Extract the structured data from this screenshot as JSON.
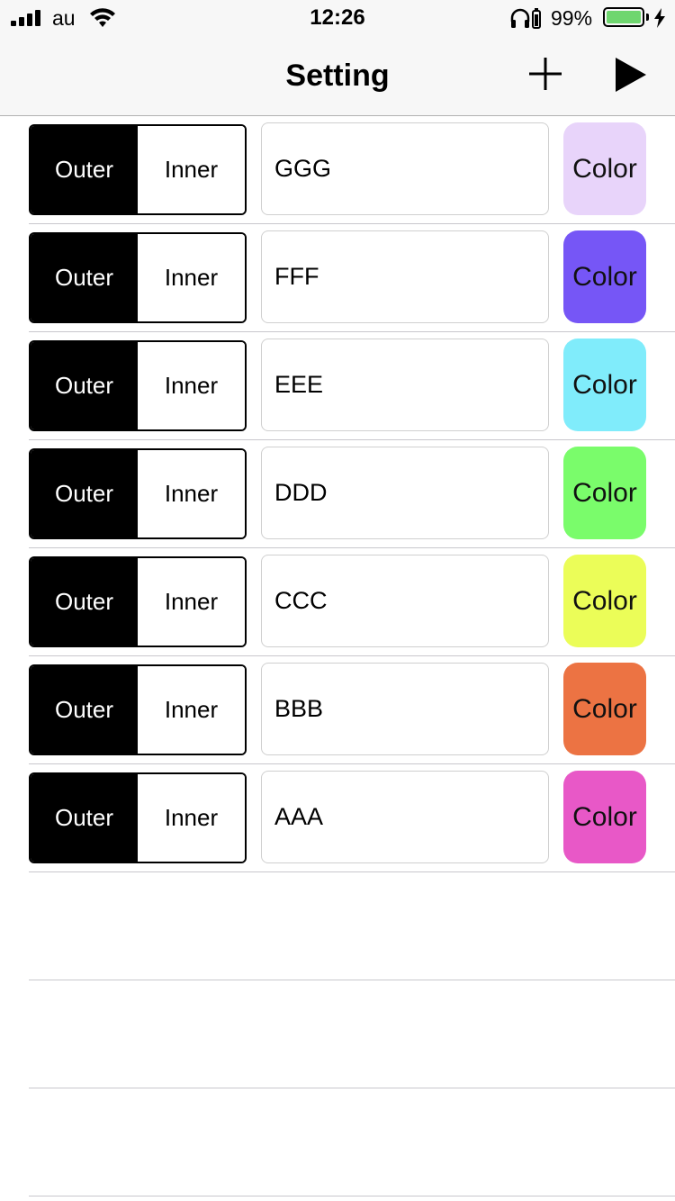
{
  "status_bar": {
    "carrier": "au",
    "time": "12:26",
    "battery_percent": "99%",
    "battery_level": 0.99,
    "battery_color": "#6fd66f",
    "icons": [
      "signal-icon",
      "wifi-icon",
      "headphones-icon",
      "battery-icon",
      "charging-bolt-icon"
    ]
  },
  "nav": {
    "title": "Setting",
    "add_icon": "plus-icon",
    "play_icon": "play-icon"
  },
  "rows": [
    {
      "outer_label": "Outer",
      "inner_label": "Inner",
      "selected": "outer",
      "name": "GGG",
      "color_label": "Color",
      "color": "#e8d4fa"
    },
    {
      "outer_label": "Outer",
      "inner_label": "Inner",
      "selected": "outer",
      "name": "FFF",
      "color_label": "Color",
      "color": "#7656f6"
    },
    {
      "outer_label": "Outer",
      "inner_label": "Inner",
      "selected": "outer",
      "name": "EEE",
      "color_label": "Color",
      "color": "#80ecfb"
    },
    {
      "outer_label": "Outer",
      "inner_label": "Inner",
      "selected": "outer",
      "name": "DDD",
      "color_label": "Color",
      "color": "#7afc6b"
    },
    {
      "outer_label": "Outer",
      "inner_label": "Inner",
      "selected": "outer",
      "name": "CCC",
      "color_label": "Color",
      "color": "#ebfd58"
    },
    {
      "outer_label": "Outer",
      "inner_label": "Inner",
      "selected": "outer",
      "name": "BBB",
      "color_label": "Color",
      "color": "#ec7343"
    },
    {
      "outer_label": "Outer",
      "inner_label": "Inner",
      "selected": "outer",
      "name": "AAA",
      "color_label": "Color",
      "color": "#e858c7"
    }
  ],
  "empty_rows": 3
}
